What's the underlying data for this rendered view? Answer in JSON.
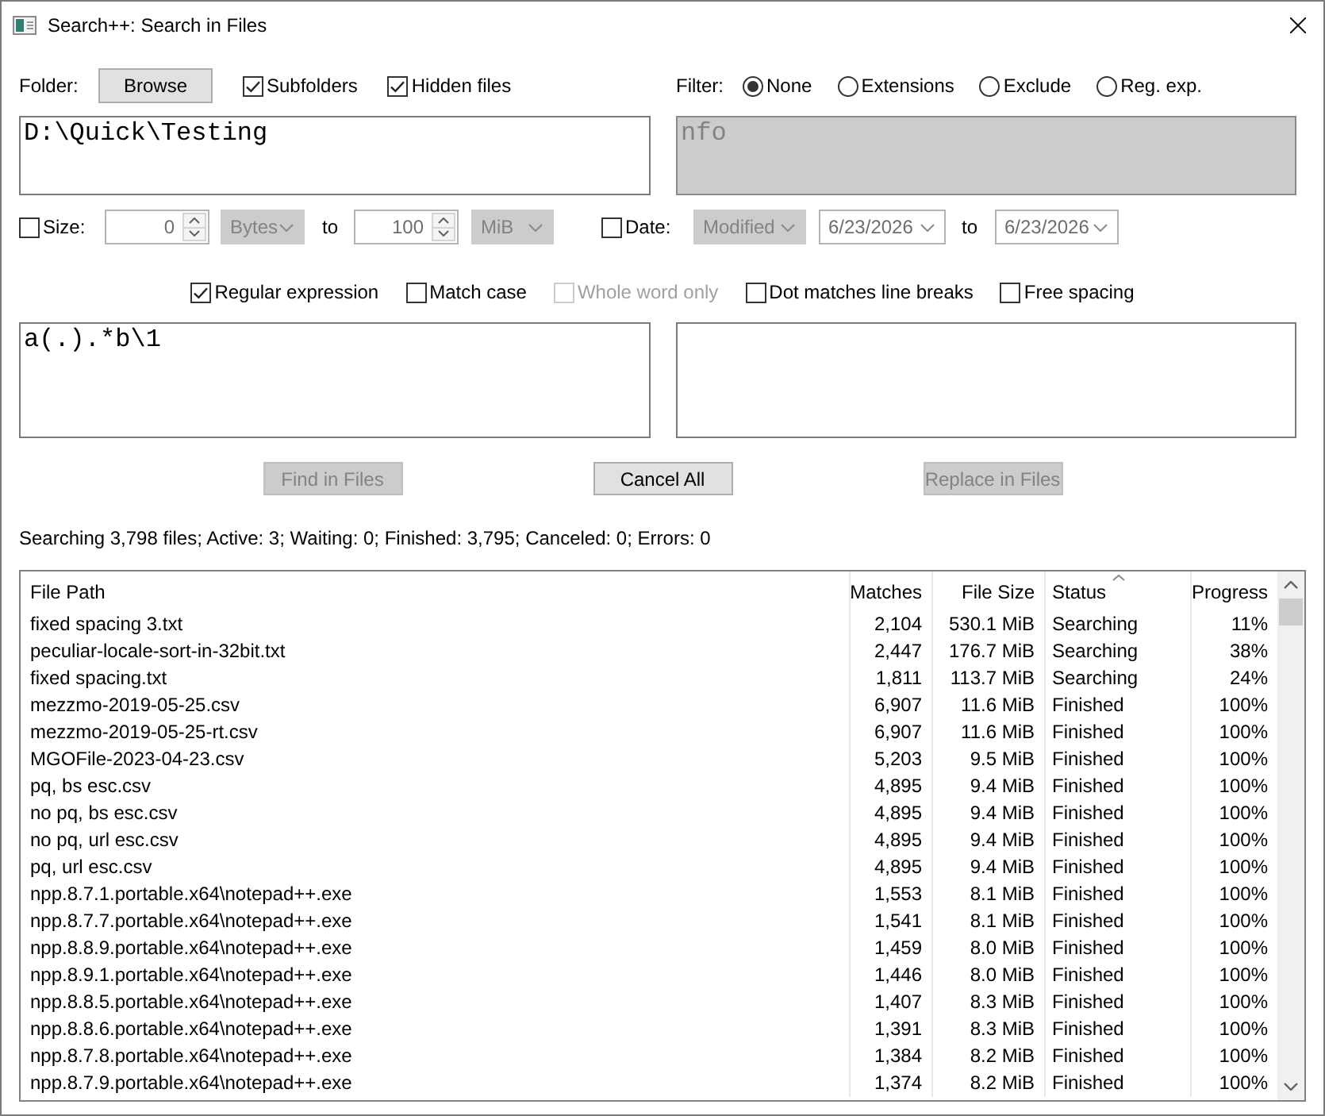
{
  "window": {
    "title": "Search++: Search in Files"
  },
  "folder": {
    "label": "Folder:",
    "browse_button": "Browse",
    "checkboxes": [
      {
        "label": "Subfolders",
        "checked": true
      },
      {
        "label": "Hidden files",
        "checked": true
      }
    ],
    "path": "D:\\Quick\\Testing"
  },
  "filter": {
    "label": "Filter:",
    "options": [
      {
        "label": "None",
        "selected": true
      },
      {
        "label": "Extensions",
        "selected": false
      },
      {
        "label": "Exclude",
        "selected": false
      },
      {
        "label": "Reg. exp.",
        "selected": false
      }
    ],
    "pattern": {
      "value": "nfo",
      "disabled": true
    }
  },
  "size": {
    "label": "Size:",
    "checked": false,
    "from": "0",
    "from_unit": "Bytes",
    "to_label": "to",
    "to": "100",
    "to_unit": "MiB"
  },
  "date": {
    "label": "Date:",
    "checked": false,
    "field": "Modified",
    "from": "6/23/2026",
    "to_label": "to",
    "to": "6/23/2026"
  },
  "options": [
    {
      "label": "Regular expression",
      "checked": true,
      "disabled": false
    },
    {
      "label": "Match case",
      "checked": false,
      "disabled": false
    },
    {
      "label": "Whole word only",
      "checked": false,
      "disabled": true
    },
    {
      "label": "Dot matches line breaks",
      "checked": false,
      "disabled": false
    },
    {
      "label": "Free spacing",
      "checked": false,
      "disabled": false
    }
  ],
  "search_text": "a(.).*b\\1",
  "buttons": [
    {
      "label": "Find in Files",
      "disabled": true
    },
    {
      "label": "Cancel All",
      "disabled": false
    },
    {
      "label": "Replace in Files",
      "disabled": true
    }
  ],
  "status": "Searching 3,798 files; Active: 3; Waiting: 0; Finished: 3,795; Canceled: 0; Errors: 0",
  "table": {
    "columns": [
      {
        "label": "File Path",
        "sorted": false
      },
      {
        "label": "Matches",
        "sorted": false
      },
      {
        "label": "File Size",
        "sorted": false
      },
      {
        "label": "Status",
        "sorted": true
      },
      {
        "label": "Progress",
        "sorted": false
      }
    ],
    "rows": [
      [
        "fixed spacing 3.txt",
        "2,104",
        "530.1 MiB",
        "Searching",
        "11%"
      ],
      [
        "peculiar-locale-sort-in-32bit.txt",
        "2,447",
        "176.7 MiB",
        "Searching",
        "38%"
      ],
      [
        "fixed spacing.txt",
        "1,811",
        "113.7 MiB",
        "Searching",
        "24%"
      ],
      [
        "mezzmo-2019-05-25.csv",
        "6,907",
        "11.6 MiB",
        "Finished",
        "100%"
      ],
      [
        "mezzmo-2019-05-25-rt.csv",
        "6,907",
        "11.6 MiB",
        "Finished",
        "100%"
      ],
      [
        "MGOFile-2023-04-23.csv",
        "5,203",
        "9.5 MiB",
        "Finished",
        "100%"
      ],
      [
        "pq, bs esc.csv",
        "4,895",
        "9.4 MiB",
        "Finished",
        "100%"
      ],
      [
        "no pq, bs esc.csv",
        "4,895",
        "9.4 MiB",
        "Finished",
        "100%"
      ],
      [
        "no pq, url esc.csv",
        "4,895",
        "9.4 MiB",
        "Finished",
        "100%"
      ],
      [
        "pq, url esc.csv",
        "4,895",
        "9.4 MiB",
        "Finished",
        "100%"
      ],
      [
        "npp.8.7.1.portable.x64\\notepad++.exe",
        "1,553",
        "8.1 MiB",
        "Finished",
        "100%"
      ],
      [
        "npp.8.7.7.portable.x64\\notepad++.exe",
        "1,541",
        "8.1 MiB",
        "Finished",
        "100%"
      ],
      [
        "npp.8.8.9.portable.x64\\notepad++.exe",
        "1,459",
        "8.0 MiB",
        "Finished",
        "100%"
      ],
      [
        "npp.8.9.1.portable.x64\\notepad++.exe",
        "1,446",
        "8.0 MiB",
        "Finished",
        "100%"
      ],
      [
        "npp.8.8.5.portable.x64\\notepad++.exe",
        "1,407",
        "8.3 MiB",
        "Finished",
        "100%"
      ],
      [
        "npp.8.8.6.portable.x64\\notepad++.exe",
        "1,391",
        "8.3 MiB",
        "Finished",
        "100%"
      ],
      [
        "npp.8.7.8.portable.x64\\notepad++.exe",
        "1,384",
        "8.2 MiB",
        "Finished",
        "100%"
      ],
      [
        "npp.8.7.9.portable.x64\\notepad++.exe",
        "1,374",
        "8.2 MiB",
        "Finished",
        "100%"
      ]
    ]
  }
}
